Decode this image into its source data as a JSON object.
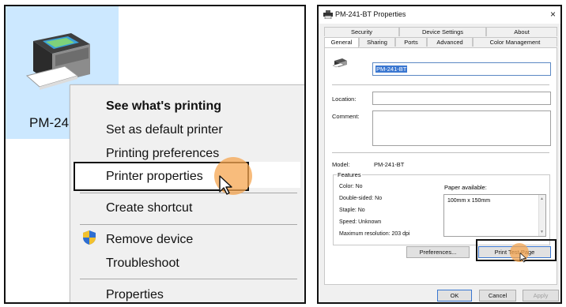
{
  "left": {
    "printer_name": "PM-241-BT",
    "menu": {
      "items": [
        "See what's printing",
        "Set as default printer",
        "Printing preferences",
        "Printer properties",
        "Create shortcut",
        "Remove device",
        "Troubleshoot",
        "Properties"
      ]
    }
  },
  "right": {
    "title": "PM-241-BT Properties",
    "close_glyph": "×",
    "tabs_top": [
      "Security",
      "Device Settings",
      "About"
    ],
    "tabs_bottom": [
      "General",
      "Sharing",
      "Ports",
      "Advanced",
      "Color Management"
    ],
    "active_tab": "General",
    "name_value": "PM-241-BT",
    "location_label": "Location:",
    "comment_label": "Comment:",
    "model_label": "Model:",
    "model_value": "PM-241-BT",
    "features": {
      "legend": "Features",
      "lines": [
        "Color: No",
        "Double-sided: No",
        "Staple: No",
        "Speed: Unknown",
        "Maximum resolution: 203 dpi"
      ],
      "paper_label": "Paper available:",
      "paper_items": [
        "100mm x 150mm"
      ]
    },
    "buttons": {
      "preferences": "Preferences...",
      "print_test": "Print Test Page",
      "ok": "OK",
      "cancel": "Cancel",
      "apply": "Apply"
    }
  },
  "colors": {
    "selection": "#cce8ff",
    "highlight_orange": "#f6a550",
    "accent_blue": "#3a77d1"
  }
}
